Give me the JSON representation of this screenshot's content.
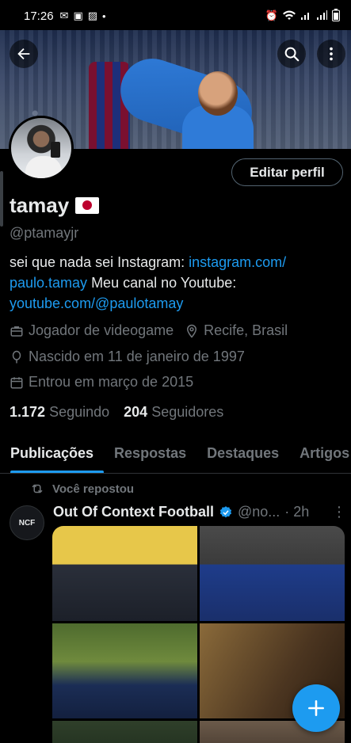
{
  "status_bar": {
    "time": "17:26",
    "left_icons": [
      "gmail-icon",
      "notification-icon",
      "gallery-icon",
      "dot-icon"
    ],
    "right_icons": [
      "alarm-icon",
      "wifi-icon",
      "signal-icon",
      "signal-icon",
      "battery-icon"
    ]
  },
  "profile": {
    "name": "tamay",
    "flag": "🇯🇵",
    "handle": "@ptamayjr",
    "edit_button": "Editar perfil",
    "bio_text_1": "sei que nada sei  Instagram: ",
    "bio_link_1": "instagram.com/\npaulo.tamay",
    "bio_text_2": " Meu canal no Youtube: ",
    "bio_link_2": "youtube.com/@paulotamay",
    "occupation": "Jogador de videogame",
    "location": "Recife, Brasil",
    "birthday": "Nascido em 11 de janeiro de 1997",
    "joined": "Entrou em março de 2015",
    "following_count": "1.172",
    "following_label": "Seguindo",
    "followers_count": "204",
    "followers_label": "Seguidores"
  },
  "tabs": [
    "Publicações",
    "Respostas",
    "Destaques",
    "Artigos"
  ],
  "active_tab": "Publicações",
  "post": {
    "repost_label": "Você repostou",
    "avatar_text": "NCF",
    "author": "Out Of Context Football",
    "handle": "@no...",
    "time": "· 2h",
    "more": "⋮"
  },
  "colors": {
    "accent": "#1d9bf0",
    "background": "#000000",
    "muted": "#71767b"
  }
}
